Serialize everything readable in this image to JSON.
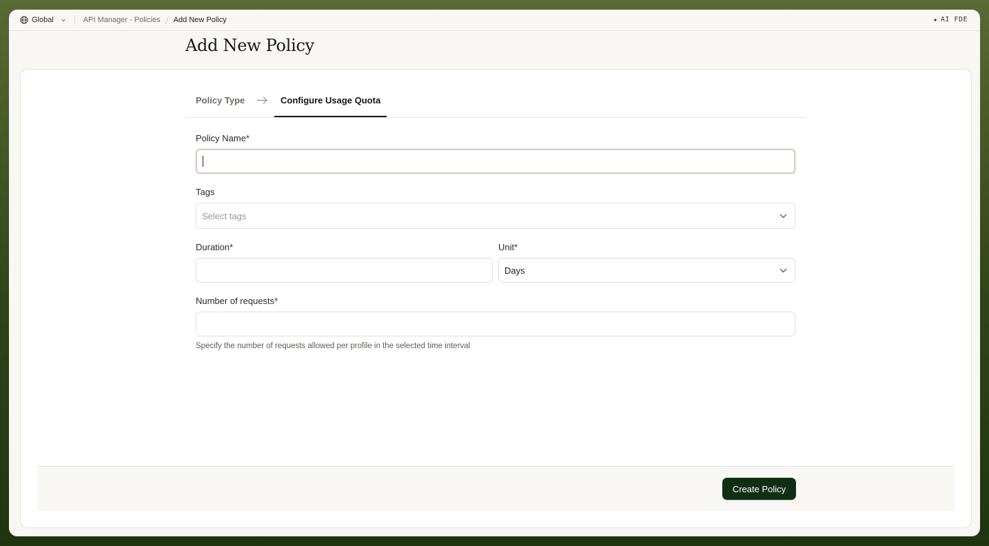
{
  "topbar": {
    "scope_label": "Global",
    "breadcrumb": [
      "API Manager - Policies",
      "Add New Policy"
    ],
    "ai_label": "AI FDE"
  },
  "page": {
    "title": "Add New Policy"
  },
  "steps": {
    "step1": "Policy Type",
    "step2": "Configure Usage Quota",
    "active": "Configure Usage Quota"
  },
  "form": {
    "policy_name": {
      "label": "Policy Name*",
      "value": ""
    },
    "tags": {
      "label": "Tags",
      "placeholder": "Select tags"
    },
    "duration": {
      "label": "Duration*",
      "value": ""
    },
    "unit": {
      "label": "Unit*",
      "value": "Days"
    },
    "requests": {
      "label": "Number of requests*",
      "value": "",
      "hint": "Specify the number of requests allowed per profile in the selected time interval"
    }
  },
  "footer": {
    "create_label": "Create Policy"
  },
  "colors": {
    "primary_button": "#0f2f14",
    "background_green": "#2f4418",
    "focus_border": "#dccbc3"
  }
}
